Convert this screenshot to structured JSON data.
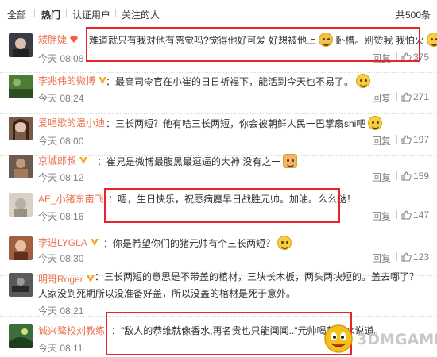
{
  "tabs": {
    "all": "全部",
    "hot": "热门",
    "verified": "认证用户",
    "following": "关注的人",
    "total": "共500条"
  },
  "comments": [
    {
      "user": "矮胖婕",
      "text": "难道就只有我对他有感觉吗?觉得他好可爱 好想被他上",
      "text_tail": "卧槽。别赞我 我怕火",
      "time": "今天 08:08",
      "reply": "回复",
      "likes": "375",
      "avatar_color": "#3b3b44"
    },
    {
      "user": "李兆伟的微博",
      "text": "：最高司令官在小崔的日日祈福下，能活到今天也不易了。",
      "time": "今天 08:24",
      "reply": "回复",
      "likes": "271",
      "avatar_color": "#4e7a3a"
    },
    {
      "user": "爱唱歌的温小迪",
      "text": "：三长两短？他有啥三长两短，你会被朝鲜人民一巴掌扇shi吧",
      "time": "今天 08:00",
      "reply": "回复",
      "likes": "197",
      "avatar_color": "#7a5a4a"
    },
    {
      "user": "京城郎叔",
      "text": "：崔兄是微博最腹黑最逗逼的大神 没有之一",
      "time": "今天 08:12",
      "reply": "回复",
      "likes": "159",
      "avatar_color": "#6b5a50"
    },
    {
      "user": "AE_小猪东南飞",
      "text": "：嗯，生日快乐，祝愿病魔早日战胜元帅。加油。么么哒！",
      "time": "今天 08:16",
      "reply": "回复",
      "likes": "147",
      "avatar_color": "#c8c0b0"
    },
    {
      "user": "李进LYGLA",
      "text": "：你是希望你们的猪元帅有个三长两短？",
      "time": "今天 08:30",
      "reply": "回复",
      "likes": "123",
      "avatar_color": "#a06040"
    },
    {
      "user": "明哥Roger",
      "text": "：三长两短的意思是不带盖的棺材，三块长木板，两头两块短的。盖去哪了？人家没到死期所以没准备好盖，所以没盖的棺材是死于意外。",
      "time": "今天 08:21",
      "reply": "回复",
      "likes": "",
      "avatar_color": "#5a5a5a"
    },
    {
      "user": "诚兴骜校刘教练",
      "text": "：\"敌人的恭维就像香水,再名贵也只能闻闻..\"元帅喝着泔水说道。",
      "time": "今天 08:11",
      "reply": "回复",
      "likes": "",
      "avatar_color": "#3a6e3a"
    }
  ],
  "watermark": "3DMGAME",
  "colors": {
    "username": "#eb7350",
    "highlight_box": "#e8232b",
    "meta": "#808080"
  }
}
